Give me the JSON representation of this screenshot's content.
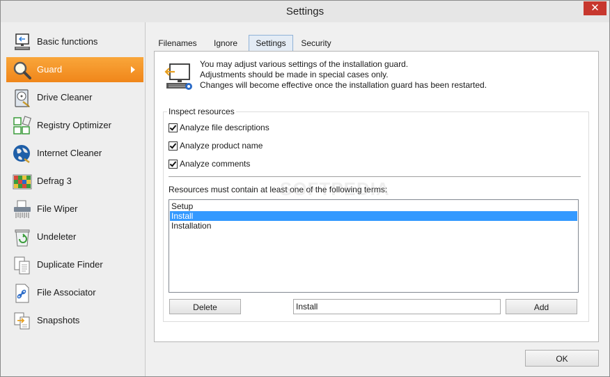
{
  "window": {
    "title": "Settings",
    "close_symbol": "✕"
  },
  "sidebar": {
    "items": [
      {
        "label": "Basic functions",
        "icon": "computer-monitor-icon",
        "active": false
      },
      {
        "label": "Guard",
        "icon": "magnifier-icon",
        "active": true
      },
      {
        "label": "Drive Cleaner",
        "icon": "hard-drive-icon",
        "active": false
      },
      {
        "label": "Registry Optimizer",
        "icon": "registry-blocks-icon",
        "active": false
      },
      {
        "label": "Internet Cleaner",
        "icon": "globe-icon",
        "active": false
      },
      {
        "label": "Defrag 3",
        "icon": "defrag-grid-icon",
        "active": false
      },
      {
        "label": "File Wiper",
        "icon": "shredder-icon",
        "active": false
      },
      {
        "label": "Undeleter",
        "icon": "recycle-bin-icon",
        "active": false
      },
      {
        "label": "Duplicate Finder",
        "icon": "duplicate-documents-icon",
        "active": false
      },
      {
        "label": "File Associator",
        "icon": "file-link-icon",
        "active": false
      },
      {
        "label": "Snapshots",
        "icon": "snapshot-documents-icon",
        "active": false
      }
    ]
  },
  "tabs": [
    {
      "label": "Filenames",
      "active": false
    },
    {
      "label": "Ignore",
      "active": false
    },
    {
      "label": "Settings",
      "active": true
    },
    {
      "label": "Security",
      "active": false
    }
  ],
  "info": {
    "icon": "installation-guard-icon",
    "line1": "You may adjust various settings of the installation guard.",
    "line2": "Adjustments should be made in special cases only.",
    "line3": "Changes will become effective once the installation guard has been restarted."
  },
  "inspect": {
    "group_label": "Inspect resources",
    "options": [
      {
        "label": "Analyze file descriptions",
        "checked": true
      },
      {
        "label": "Analyze product name",
        "checked": true
      },
      {
        "label": "Analyze comments",
        "checked": true
      }
    ]
  },
  "terms": {
    "label": "Resources must contain at least one of the following terms:",
    "items": [
      "Setup",
      "Install",
      "Installation"
    ],
    "selected": "Install",
    "input_value": "Install",
    "delete_label": "Delete",
    "add_label": "Add"
  },
  "footer": {
    "ok_label": "OK"
  },
  "watermark": "SOFTPEDIA",
  "colors": {
    "active_nav": "#f0861a",
    "selection": "#3399ff",
    "close": "#c7372e"
  }
}
